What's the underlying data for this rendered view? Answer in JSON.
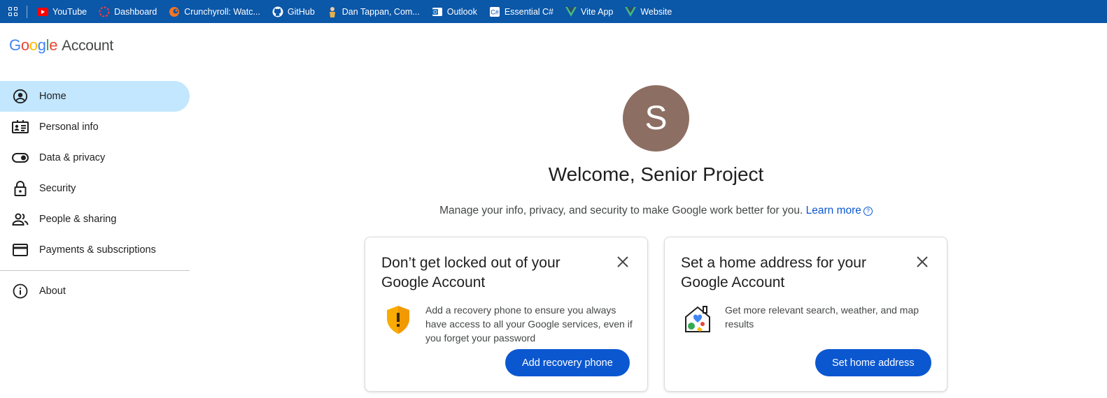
{
  "bookmarks": [
    {
      "label": "YouTube",
      "icon": "youtube-icon"
    },
    {
      "label": "Dashboard",
      "icon": "dashboard-icon"
    },
    {
      "label": "Crunchyroll: Watc...",
      "icon": "crunchyroll-icon"
    },
    {
      "label": "GitHub",
      "icon": "github-icon"
    },
    {
      "label": "Dan Tappan, Com...",
      "icon": "person-icon"
    },
    {
      "label": "Outlook",
      "icon": "outlook-icon"
    },
    {
      "label": "Essential C#",
      "icon": "csharp-icon"
    },
    {
      "label": "Vite App",
      "icon": "vue-icon"
    },
    {
      "label": "Website",
      "icon": "vue-icon"
    }
  ],
  "logo": {
    "letters": [
      "G",
      "o",
      "o",
      "g",
      "l",
      "e"
    ],
    "colors": [
      "#4285f4",
      "#ea4335",
      "#fbbc05",
      "#4285f4",
      "#34a853",
      "#ea4335"
    ],
    "suffix": "Account"
  },
  "sidebar": {
    "items": [
      {
        "label": "Home",
        "icon": "account-circle-icon",
        "active": true
      },
      {
        "label": "Personal info",
        "icon": "id-card-icon"
      },
      {
        "label": "Data & privacy",
        "icon": "toggle-icon"
      },
      {
        "label": "Security",
        "icon": "lock-icon"
      },
      {
        "label": "People & sharing",
        "icon": "people-icon"
      },
      {
        "label": "Payments & subscriptions",
        "icon": "credit-card-icon"
      }
    ],
    "footer_items": [
      {
        "label": "About",
        "icon": "info-icon"
      }
    ]
  },
  "main": {
    "avatar_letter": "S",
    "avatar_color": "#8d6e63",
    "welcome": "Welcome, Senior Project",
    "subtitle": "Manage your info, privacy, and security to make Google work better for you.",
    "learn_more": "Learn more",
    "cards": [
      {
        "title": "Don’t get locked out of your Google Account",
        "text": "Add a recovery phone to ensure you always have access to all your Google services, even if you forget your password",
        "button": "Add recovery phone",
        "icon": "shield-warning-icon"
      },
      {
        "title": "Set a home address for your Google Account",
        "text": "Get more relevant search, weather, and map results",
        "button": "Set home address",
        "icon": "home-map-icon"
      }
    ]
  },
  "colors": {
    "accent": "#0b57d0",
    "bookmark_bar": "#0b57a8",
    "active_nav": "#c2e7ff"
  }
}
